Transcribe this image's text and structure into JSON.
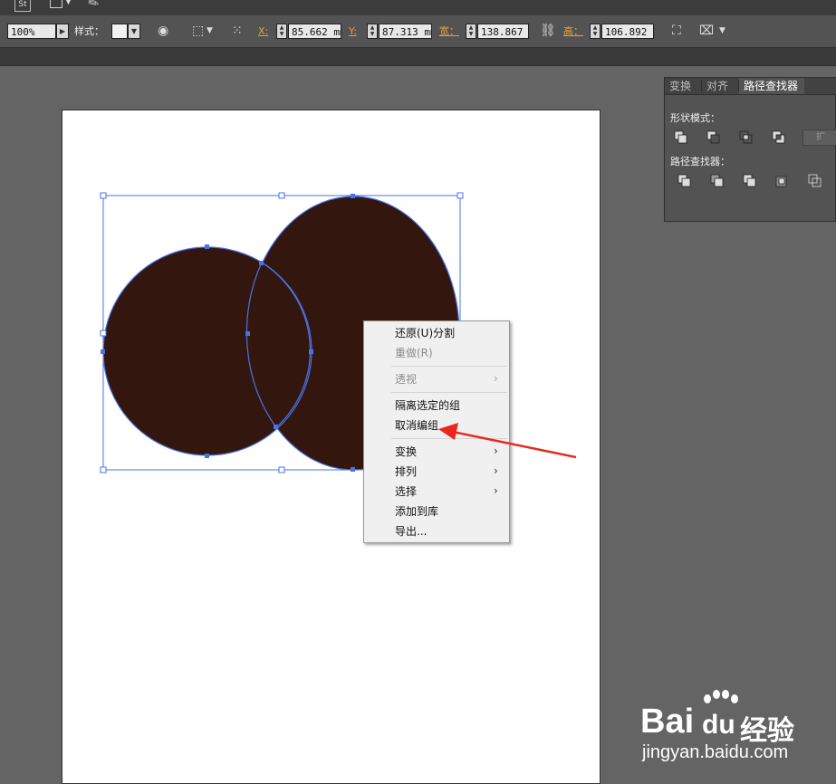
{
  "toolbar": {
    "app_badge": "St",
    "zoom_value": "100%",
    "style_label": "样式：",
    "x_label": "X:",
    "x_value": "85.662 mm",
    "y_label": "Y:",
    "y_value": "87.313 mm",
    "w_label": "宽：",
    "w_value": "138.867 mm",
    "h_label": "高：",
    "h_value": "106.892 mm"
  },
  "panel": {
    "tabs": [
      "变换",
      "对齐",
      "路径查找器"
    ],
    "active_tab": "路径查找器",
    "shape_modes_label": "形状模式：",
    "expand_label": "扩",
    "pathfinders_label": "路径查找器："
  },
  "context_menu": {
    "items": [
      {
        "label": "还原(U)分割",
        "enabled": true,
        "submenu": false
      },
      {
        "label": "重做(R)",
        "enabled": false,
        "submenu": false
      },
      {
        "label": "透视",
        "enabled": false,
        "submenu": true
      },
      {
        "label": "隔离选定的组",
        "enabled": true,
        "submenu": false
      },
      {
        "label": "取消编组",
        "enabled": true,
        "submenu": false,
        "highlighted_by_arrow": true
      },
      {
        "label": "变换",
        "enabled": true,
        "submenu": true
      },
      {
        "label": "排列",
        "enabled": true,
        "submenu": true
      },
      {
        "label": "选择",
        "enabled": true,
        "submenu": true
      },
      {
        "label": "添加到库",
        "enabled": true,
        "submenu": false
      },
      {
        "label": "导出...",
        "enabled": true,
        "submenu": false
      }
    ],
    "submenu_glyph": "›"
  },
  "watermark": {
    "brand": "Bai",
    "brand_paw": "du",
    "suffix": "经验",
    "url": "jingyan.baidu.com"
  },
  "colors": {
    "shape_fill": "#33170e",
    "selection": "#4a72e8",
    "annotation_arrow": "#e8281e"
  }
}
